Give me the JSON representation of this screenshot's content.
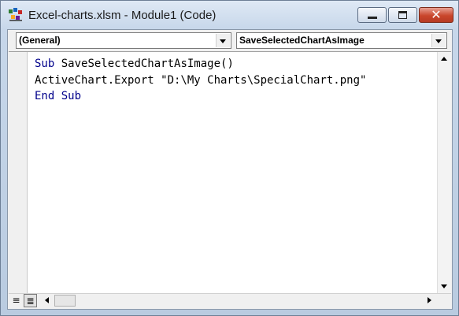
{
  "window": {
    "title": "Excel-charts.xlsm - Module1 (Code)"
  },
  "icons": {
    "app": "vba-editor-icon",
    "minimize": "minimize-icon",
    "maximize": "maximize-icon",
    "close": "close-icon"
  },
  "colors": {
    "keyword": "#00008b",
    "close_button": "#c9462c",
    "chrome": "#c7d7ea"
  },
  "dropdowns": {
    "object": {
      "value": "(General)"
    },
    "procedure": {
      "value": "SaveSelectedChartAsImage"
    }
  },
  "code": {
    "line1": {
      "keyword": "Sub",
      "rest": " SaveSelectedChartAsImage()"
    },
    "line2": "ActiveChart.Export \"D:\\My Charts\\SpecialChart.png\"",
    "line3": {
      "keyword": "End Sub"
    }
  },
  "view_buttons": {
    "procedure_view": "≡",
    "full_module_view": "≣"
  }
}
